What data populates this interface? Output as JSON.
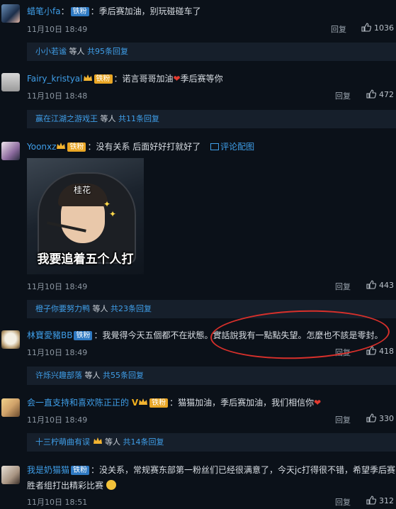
{
  "ui": {
    "reply_label": "回复",
    "etc_label": "等人",
    "heart": "❤",
    "colors": {
      "background": "#0b1119",
      "link": "#3f9ee8",
      "subbar": "#161f2b",
      "highlight_ellipse": "#d8302b",
      "badge_blue": "#2e79c2"
    }
  },
  "comments": [
    {
      "username": "蜡笔小fa",
      "badge": "铁粉",
      "text": "季后赛加油，别玩碰碰车了",
      "timestamp": "11月10日 18:49",
      "likes": "1036",
      "sub": {
        "name": "小小若谧",
        "count": "共95条回复"
      }
    },
    {
      "username": "Fairy_kristyal",
      "badge": "铁粉",
      "text_a": "诺言哥哥加油",
      "text_b": "季后赛等你",
      "timestamp": "11月10日 18:48",
      "likes": "472",
      "sub": {
        "name": "赢在江湖之游戏王",
        "count": "共11条回复"
      }
    },
    {
      "username": "Yoonxz",
      "badge": "铁粉",
      "text": "没有关系 后面好好打就好了",
      "link": "评论配图",
      "image": {
        "tag": "桂花",
        "caption": "我要追着五个人打"
      },
      "timestamp": "11月10日 18:49",
      "likes": "443",
      "sub": {
        "name": "橙子你要努力鸭",
        "count": "共23条回复"
      }
    },
    {
      "username": "林寶愛豬BB",
      "badge": "铁粉",
      "text_a": "我覺得今天五個都不在狀態。",
      "text_b": "實話說我有一點點失望。怎麼也不該是零封。",
      "timestamp": "11月10日 18:49",
      "likes": "418",
      "sub": {
        "name": "许烁兴趣部落",
        "count": "共55条回复"
      }
    },
    {
      "username": "会一直支持和喜欢陈正正的",
      "vmark": "V",
      "badge": "铁粉",
      "text": "猫猫加油，季后赛加油，我们相信你",
      "timestamp": "11月10日 18:49",
      "likes": "330",
      "sub": {
        "name": "十三柠萌曲有误",
        "count": "共14条回复"
      }
    },
    {
      "username": "我是奶猫猫",
      "badge": "铁粉",
      "text_line1": "没关系，常规赛东部第一粉丝们已经很满意了，今天jc打得很不错，希望季后赛",
      "text_line2": "胜者组打出精彩比赛",
      "timestamp": "11月10日 18:51",
      "likes": "312"
    }
  ]
}
